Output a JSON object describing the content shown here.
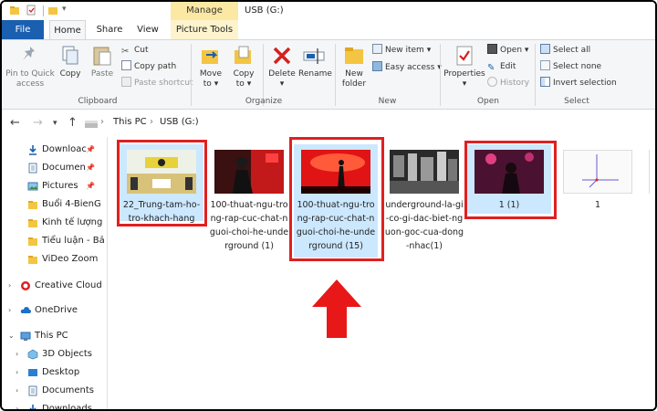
{
  "titlebar": {
    "contextual_tab": "Manage",
    "window_title": "USB (G:)"
  },
  "tabs": {
    "file": "File",
    "home": "Home",
    "share": "Share",
    "view": "View",
    "picture_tools": "Picture Tools"
  },
  "ribbon": {
    "clipboard": {
      "pin_label_1": "Pin to Quick",
      "pin_label_2": "access",
      "copy": "Copy",
      "paste": "Paste",
      "cut": "Cut",
      "copy_path": "Copy path",
      "paste_shortcut": "Paste shortcut",
      "group": "Clipboard"
    },
    "organize": {
      "move_to_1": "Move",
      "move_to_2": "to",
      "copy_to_1": "Copy",
      "copy_to_2": "to",
      "delete": "Delete",
      "rename": "Rename",
      "group": "Organize"
    },
    "new": {
      "new_folder_1": "New",
      "new_folder_2": "folder",
      "new_item": "New item",
      "easy_access": "Easy access",
      "group": "New"
    },
    "open": {
      "properties": "Properties",
      "open": "Open",
      "edit": "Edit",
      "history": "History",
      "group": "Open"
    },
    "select": {
      "select_all": "Select all",
      "select_none": "Select none",
      "invert_selection": "Invert selection",
      "group": "Select"
    }
  },
  "address": {
    "crumbs": [
      "This PC",
      "USB (G:)"
    ]
  },
  "nav": {
    "items": [
      {
        "label": "Downloac",
        "icon": "download-icon",
        "pinned": true
      },
      {
        "label": "Documen",
        "icon": "documents-icon",
        "pinned": true
      },
      {
        "label": "Pictures",
        "icon": "pictures-icon",
        "pinned": true
      },
      {
        "label": "Buổi 4-BienG",
        "icon": "folder-icon"
      },
      {
        "label": "Kinh tế lượng",
        "icon": "folder-icon"
      },
      {
        "label": "Tiểu luận - Bả",
        "icon": "folder-icon"
      },
      {
        "label": "ViDeo Zoom",
        "icon": "folder-icon"
      },
      {
        "label": "Creative Cloud",
        "icon": "creative-cloud-icon"
      },
      {
        "label": "OneDrive",
        "icon": "onedrive-icon"
      },
      {
        "label": "This PC",
        "icon": "this-pc-icon"
      },
      {
        "label": "3D Objects",
        "icon": "3d-objects-icon"
      },
      {
        "label": "Desktop",
        "icon": "desktop-icon"
      },
      {
        "label": "Documents",
        "icon": "documents-icon"
      },
      {
        "label": "Downloads",
        "icon": "download-icon"
      }
    ]
  },
  "files": [
    {
      "name": "22_Trung-tam-ho-tro-khach-hang",
      "selected": true,
      "highlighted": true
    },
    {
      "name": "100-thuat-ngu-trong-rap-cuc-chat-nguoi-choi-he-underground (1)",
      "selected": false,
      "highlighted": false
    },
    {
      "name": "100-thuat-ngu-trong-rap-cuc-chat-nguoi-choi-he-underground (15)",
      "selected": true,
      "highlighted": true
    },
    {
      "name": "underground-la-gi-co-gi-dac-biet-nguon-goc-cua-dong-nhac(1)",
      "selected": false,
      "highlighted": false
    },
    {
      "name": "1 (1)",
      "selected": true,
      "highlighted": true
    },
    {
      "name": "1",
      "selected": false,
      "highlighted": false
    }
  ],
  "colors": {
    "accent": "#1a5fb0",
    "selection": "#cce8ff",
    "highlight": "#e02020",
    "manage_tab": "#fbe8a3"
  }
}
